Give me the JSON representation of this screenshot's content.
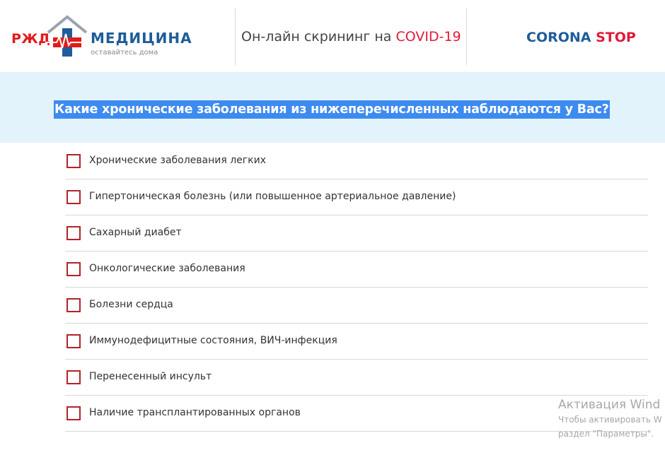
{
  "header": {
    "logo": {
      "rzd": "РЖД",
      "name": "МЕДИЦИНА",
      "tagline": "оставайтесь дома"
    },
    "screening": {
      "prefix": "Он-лайн скрининг на ",
      "highlight": "COVID-19"
    },
    "brand": {
      "part1": "CORONA",
      "part2": "STOP"
    }
  },
  "question": "Какие хронические заболевания из нижеперечисленных наблюдаются у Вас?",
  "options": [
    {
      "label": "Хронические заболевания легких",
      "checked": false
    },
    {
      "label": "Гипертоническая болезнь (или повышенное артериальное давление)",
      "checked": false
    },
    {
      "label": "Сахарный диабет",
      "checked": false
    },
    {
      "label": "Онкологические заболевания",
      "checked": false
    },
    {
      "label": "Болезни сердца",
      "checked": false
    },
    {
      "label": "Иммунодефицитные состояния, ВИЧ-инфекция",
      "checked": false
    },
    {
      "label": "Перенесенный инсульт",
      "checked": false
    },
    {
      "label": "Наличие трансплантированных органов",
      "checked": false
    }
  ],
  "watermark": {
    "title": "Активация Wind",
    "line1": "Чтобы активировать W",
    "line2": "раздел \"Параметры\"."
  },
  "colors": {
    "brand_red": "#e21a1a",
    "brand_blue": "#1f5c9a",
    "question_band": "#e3f3fb",
    "selection": "#3d8bf0",
    "checkbox_border": "#b3232a"
  },
  "icons": {
    "logo": "house-cross-heartbeat-icon",
    "checkbox": "checkbox-empty-icon"
  }
}
